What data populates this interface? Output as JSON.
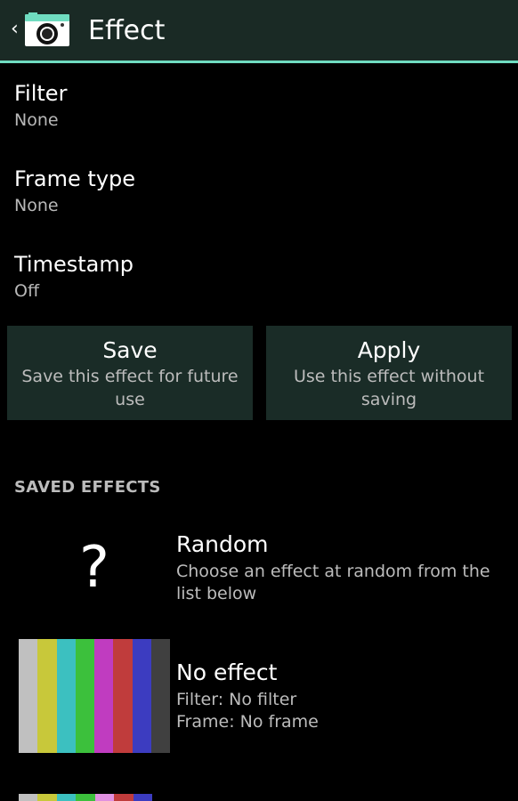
{
  "actionbar": {
    "back_glyph": "‹",
    "title": "Effect",
    "app_icon": "camera-icon"
  },
  "prefs": [
    {
      "title": "Filter",
      "summary": "None"
    },
    {
      "title": "Frame type",
      "summary": "None"
    },
    {
      "title": "Timestamp",
      "summary": "Off"
    }
  ],
  "buttons": {
    "save": {
      "title": "Save",
      "subtitle": "Save this effect for future use"
    },
    "apply": {
      "title": "Apply",
      "subtitle": "Use this effect without saving"
    }
  },
  "saved_effects": {
    "header": "SAVED EFFECTS",
    "items": [
      {
        "title": "Random",
        "lines": [
          "Choose an effect at random from the list below"
        ],
        "thumb_glyph": "?"
      },
      {
        "title": "No effect",
        "lines": [
          "Filter: No filter",
          "Frame: No frame"
        ]
      }
    ]
  },
  "colors": {
    "accent": "#6fdcc0",
    "bar_bg": "#1a2a25",
    "button_bg": "#1a2c27",
    "test_bars": [
      "#c0c0c0",
      "#c8c83a",
      "#3cc0c0",
      "#3cc03c",
      "#c03cc0",
      "#c03c3c",
      "#3c3cc0",
      "#404040"
    ],
    "partial_bars": [
      "#c0c0c0",
      "#c8c83a",
      "#3cc0c0",
      "#3cc03c",
      "#e090e0",
      "#c03c3c",
      "#3c3cc0"
    ]
  }
}
